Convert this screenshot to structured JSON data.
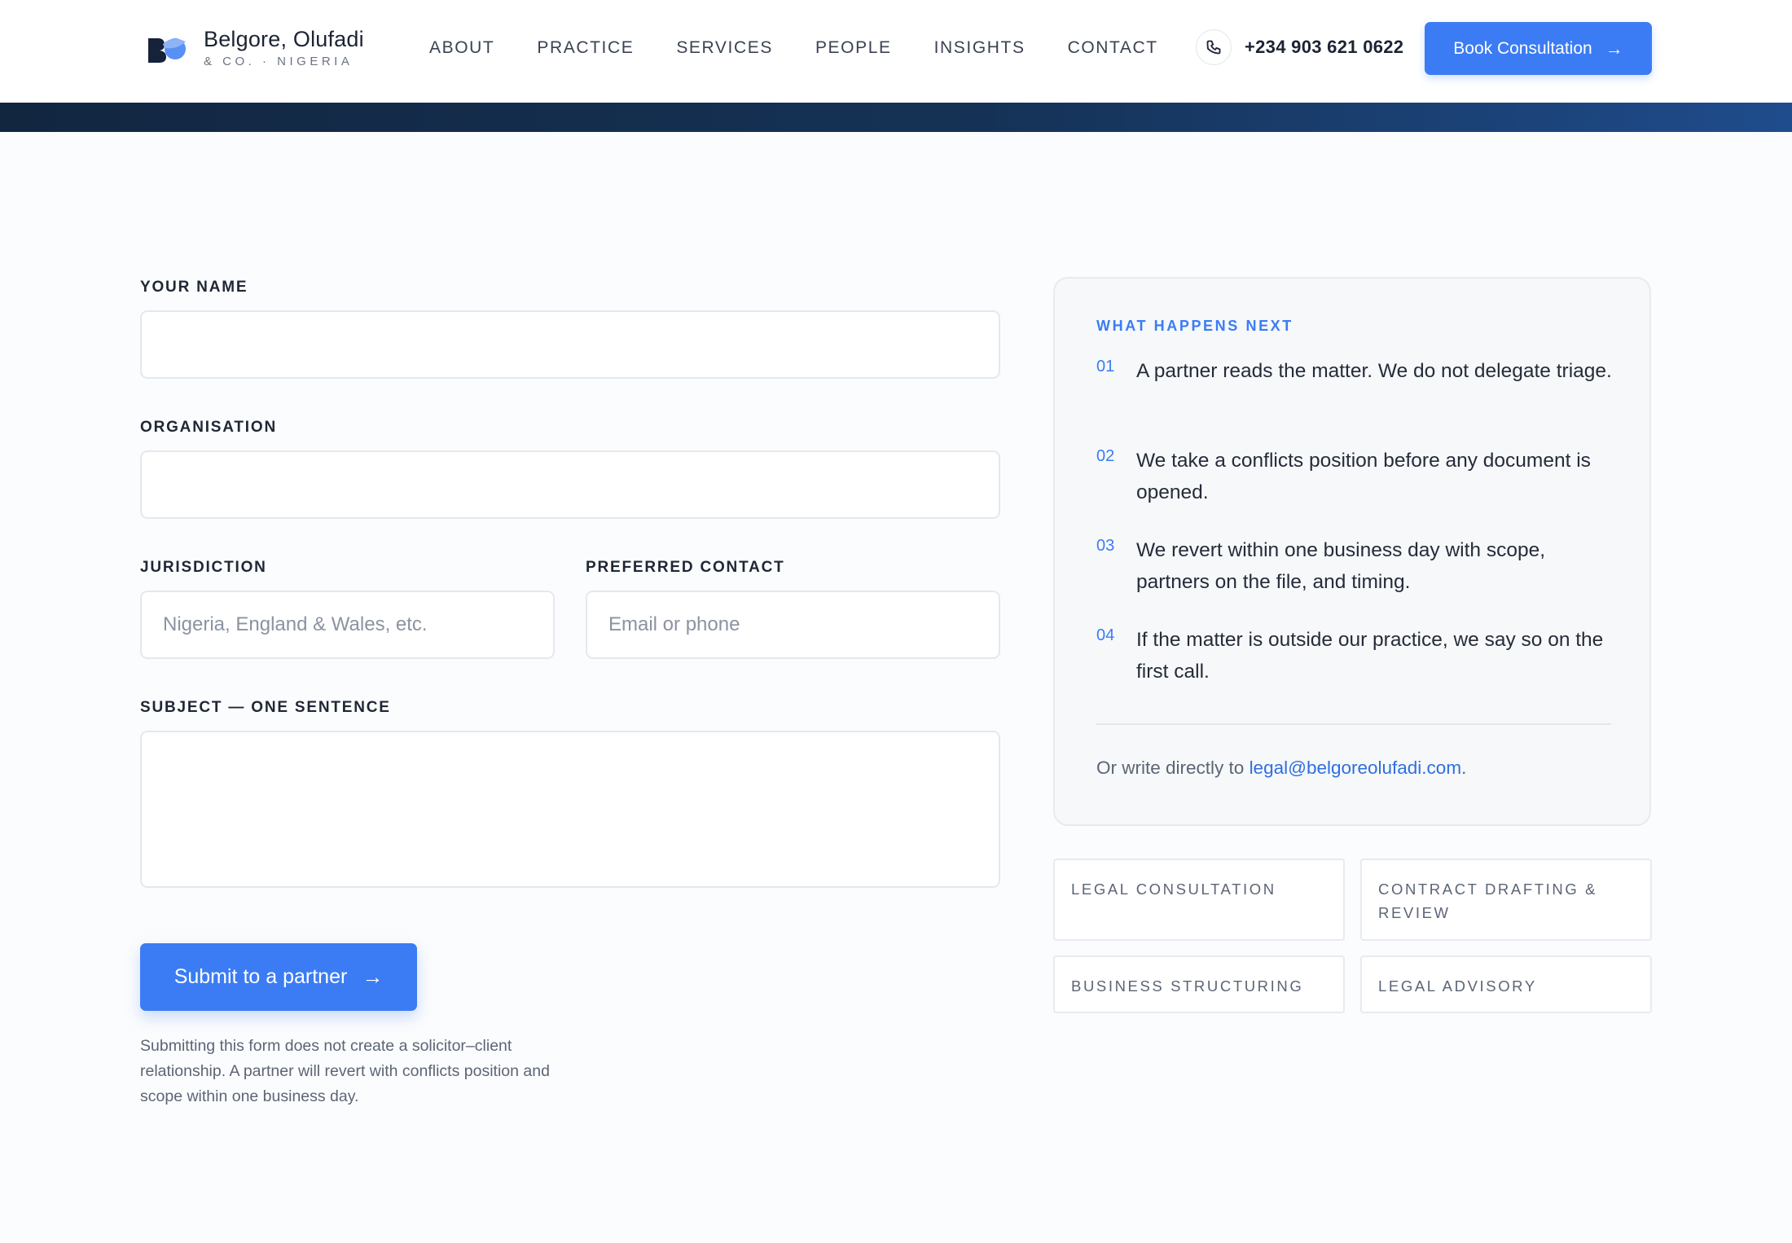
{
  "brand": {
    "name": "Belgore, Olufadi",
    "sub": "& CO. · NIGERIA"
  },
  "nav": [
    {
      "label": "ABOUT"
    },
    {
      "label": "PRACTICE"
    },
    {
      "label": "SERVICES"
    },
    {
      "label": "PEOPLE"
    },
    {
      "label": "INSIGHTS"
    },
    {
      "label": "CONTACT"
    }
  ],
  "header": {
    "phone": "+234 903 621 0622",
    "book_label": "Book Consultation",
    "arrow": "→"
  },
  "form": {
    "name_label": "YOUR NAME",
    "org_label": "ORGANISATION",
    "jurisdiction_label": "JURISDICTION",
    "jurisdiction_placeholder": "Nigeria, England & Wales, etc.",
    "contact_label": "PREFERRED CONTACT",
    "contact_placeholder": "Email or phone",
    "subject_label": "SUBJECT — ONE SENTENCE",
    "submit_label": "Submit to a partner",
    "submit_arrow": "→",
    "disclaimer": "Submitting this form does not create a solicitor–client relationship. A partner will revert with conflicts position and scope within one business day."
  },
  "panel": {
    "eyebrow": "WHAT HAPPENS NEXT",
    "steps": [
      {
        "num": "01",
        "text": "A partner reads the matter. We do not delegate triage."
      },
      {
        "num": "02",
        "text": "We take a conflicts position before any document is opened."
      },
      {
        "num": "03",
        "text": "We revert within one business day with scope, partners on the file, and timing."
      },
      {
        "num": "04",
        "text": "If the matter is outside our practice, we say so on the first call."
      }
    ],
    "footer_prefix": "Or write directly to",
    "email": "legal@belgoreolufadi.com",
    "footer_suffix": "."
  },
  "tags": [
    {
      "label": "LEGAL CONSULTATION"
    },
    {
      "label": "CONTRACT DRAFTING & REVIEW"
    },
    {
      "label": "BUSINESS STRUCTURING"
    },
    {
      "label": "LEGAL ADVISORY"
    }
  ],
  "colors": {
    "accent": "#3b7cf4",
    "navy_band": "#153256",
    "text": "#1c2333"
  },
  "icons": {
    "logo": "bo-logo-mark",
    "phone": "phone-icon",
    "arrow": "arrow-right-icon"
  }
}
